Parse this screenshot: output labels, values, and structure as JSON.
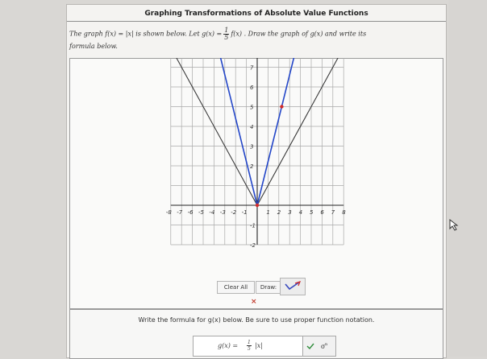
{
  "header": {
    "title": "Graphing Transformations of Absolute Value Functions"
  },
  "problem": {
    "lead": "The graph ",
    "f_def": "f(x) = |x|",
    "mid": " is shown below. Let ",
    "g_lhs": "g(x) =",
    "frac_num": "1",
    "frac_den": "5",
    "g_rhs": "f(x)",
    "tail": " . Draw the graph of ",
    "g_name": "g(x)",
    "tail2": " and write its",
    "line2": "formula below."
  },
  "graph": {
    "x_ticks": [
      "-8",
      "-7",
      "-6",
      "-5",
      "-4",
      "-3",
      "-2",
      "-1",
      "1",
      "2",
      "3",
      "4",
      "5",
      "6",
      "7",
      "8"
    ],
    "y_ticks": [
      "8",
      "7",
      "6",
      "5",
      "4",
      "3",
      "2",
      "-1",
      "-2"
    ],
    "colors": {
      "original": "#3a3a3a",
      "student": "#2346c8",
      "point": "#d22a2a"
    }
  },
  "controls": {
    "clear_all": "Clear All",
    "draw_label": "Draw:",
    "status_x": "×"
  },
  "answer": {
    "instruction": "Write the formula for g(x) below. Be sure to use proper function notation.",
    "input_lhs": "g(x) =",
    "input_num": "1",
    "input_den": "5",
    "input_rhs": "|x|"
  }
}
